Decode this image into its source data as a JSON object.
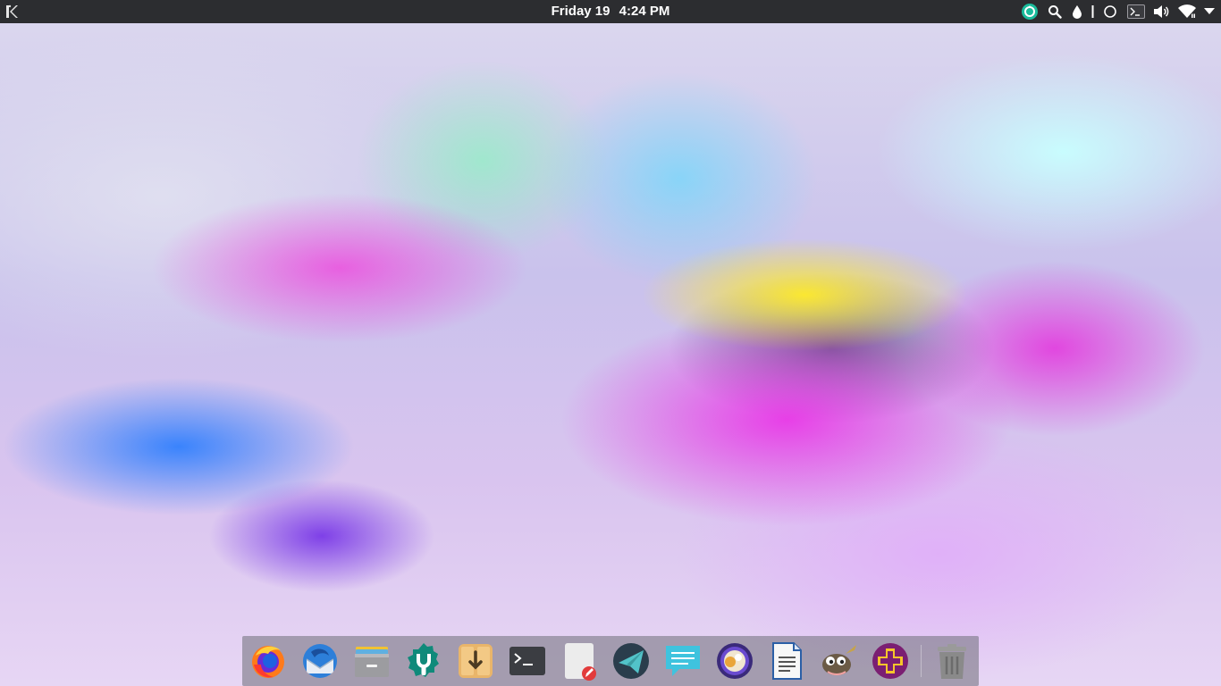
{
  "top_panel": {
    "clock": {
      "day": "Friday 19",
      "time": "4:24 PM"
    },
    "launcher_icon": "kde-logo",
    "tray_icons": [
      "update-manager-icon",
      "search-icon",
      "color-picker-icon",
      "night-mode-icon",
      "terminal-icon",
      "volume-icon",
      "wifi-icon",
      "menu-arrow-icon"
    ]
  },
  "dock": {
    "apps": [
      {
        "name": "Firefox",
        "icon": "firefox-icon"
      },
      {
        "name": "Thunderbird",
        "icon": "thunderbird-icon"
      },
      {
        "name": "Files",
        "icon": "file-manager-icon"
      },
      {
        "name": "Software Center",
        "icon": "software-center-icon"
      },
      {
        "name": "Downloads",
        "icon": "downloader-icon"
      },
      {
        "name": "Terminal",
        "icon": "terminal-icon"
      },
      {
        "name": "Text Editor",
        "icon": "text-editor-icon"
      },
      {
        "name": "Telegram",
        "icon": "telegram-icon"
      },
      {
        "name": "Messages",
        "icon": "chat-icon"
      },
      {
        "name": "Music",
        "icon": "music-player-icon"
      },
      {
        "name": "Document Writer",
        "icon": "writer-icon"
      },
      {
        "name": "GIMP",
        "icon": "gimp-icon"
      },
      {
        "name": "Add",
        "icon": "add-icon"
      }
    ],
    "trash": {
      "name": "Trash",
      "icon": "trash-icon"
    }
  },
  "colors": {
    "panel": "#2c2d30",
    "dock": "#6e6e76"
  }
}
